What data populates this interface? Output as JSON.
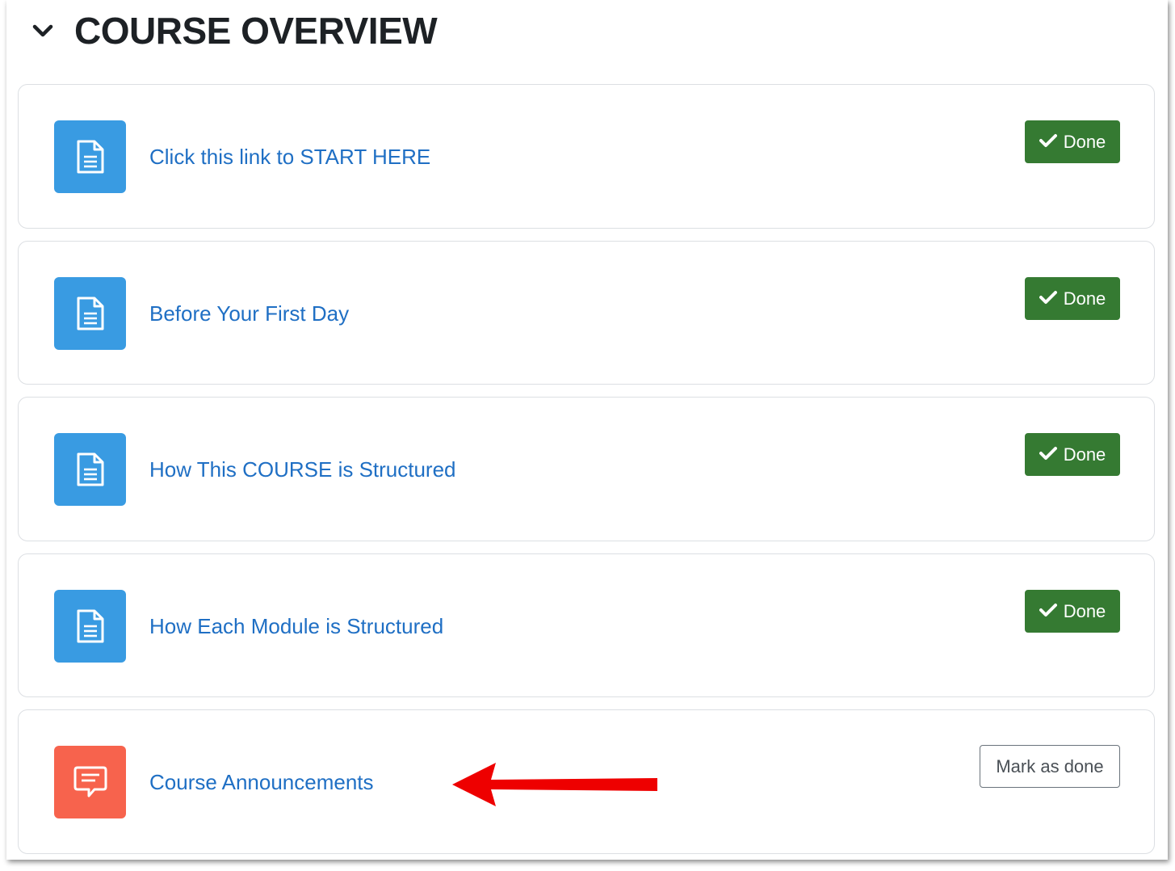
{
  "section": {
    "title": "COURSE OVERVIEW",
    "toggle_icon": "chevron-down-icon"
  },
  "activities": [
    {
      "label": "Click this link to START HERE",
      "type": "resource",
      "icon": "document-icon",
      "status": "Done"
    },
    {
      "label": "Before Your First Day",
      "type": "resource",
      "icon": "document-icon",
      "status": "Done"
    },
    {
      "label": "How This COURSE is Structured",
      "type": "resource",
      "icon": "document-icon",
      "status": "Done"
    },
    {
      "label": "How Each Module is Structured",
      "type": "resource",
      "icon": "document-icon",
      "status": "Done"
    },
    {
      "label": "Course Announcements",
      "type": "forum",
      "icon": "forum-chat-icon",
      "status": "Mark as done"
    }
  ],
  "colors": {
    "resource_icon_bg": "#399be2",
    "forum_icon_bg": "#f7634d",
    "done_green": "#357a32",
    "link_blue": "#1f6fc4",
    "annotation_arrow": "#ee0000"
  },
  "annotation": {
    "icon": "red-arrow-icon"
  }
}
